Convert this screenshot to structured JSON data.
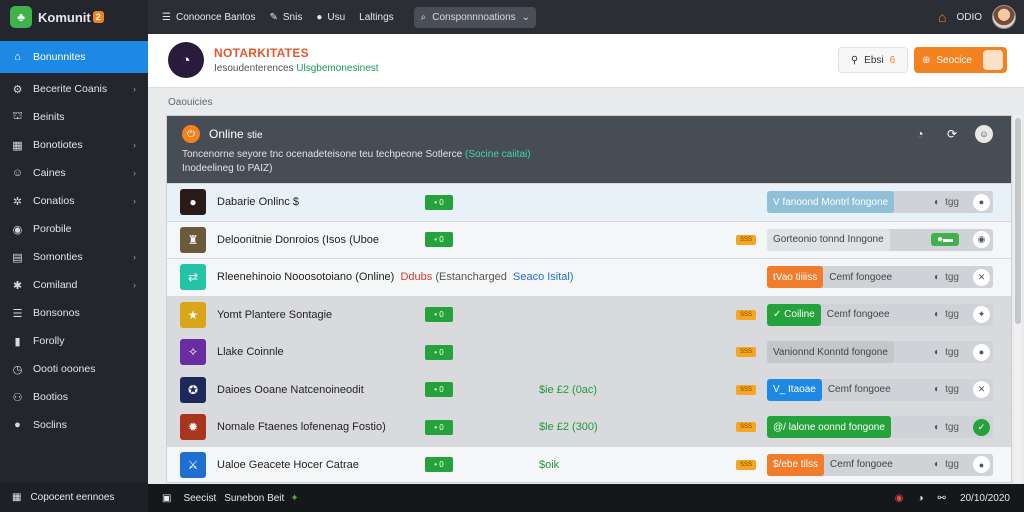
{
  "app": {
    "brand": "Komunit",
    "brand_badge": "2"
  },
  "sidebar": {
    "items": [
      {
        "label": "Bonunnites",
        "icon": "home-icon",
        "glyph": "⌂",
        "chevron": false,
        "active": true
      },
      {
        "label": "Becerite Coanis",
        "icon": "gear-icon",
        "glyph": "⚙",
        "chevron": true
      },
      {
        "label": "Beinits",
        "icon": "bank-icon",
        "glyph": "⛫",
        "chevron": false
      },
      {
        "label": "Bonotiotes",
        "icon": "grid-icon",
        "glyph": "▦",
        "chevron": true
      },
      {
        "label": "Caines",
        "icon": "user-icon",
        "glyph": "☺",
        "chevron": true
      },
      {
        "label": "Conatios",
        "icon": "settings-icon",
        "glyph": "✲",
        "chevron": true
      },
      {
        "label": "Porobile",
        "icon": "globe-icon",
        "glyph": "◉",
        "chevron": false
      },
      {
        "label": "Somonties",
        "icon": "layers-icon",
        "glyph": "▤",
        "chevron": true
      },
      {
        "label": "Comiland",
        "icon": "cog-icon",
        "glyph": "✱",
        "chevron": true
      },
      {
        "label": "Bonsonos",
        "icon": "list-icon",
        "glyph": "☰",
        "chevron": false
      },
      {
        "label": "Forolly",
        "icon": "book-icon",
        "glyph": "▮",
        "chevron": false
      },
      {
        "label": "Oooti ooones",
        "icon": "clock-icon",
        "glyph": "◷",
        "chevron": false
      },
      {
        "label": "Bootios",
        "icon": "users-icon",
        "glyph": "⚇",
        "chevron": false
      },
      {
        "label": "Soclins",
        "icon": "circle-icon",
        "glyph": "●",
        "chevron": false
      }
    ],
    "footer": "Copocent eennoes"
  },
  "topbar": {
    "items": [
      {
        "label": "Conoonce Bantos",
        "icon": "menu-icon",
        "glyph": "☰"
      },
      {
        "label": "Snis",
        "icon": "wand-icon",
        "glyph": "✎"
      },
      {
        "label": "Usu",
        "icon": "chat-icon",
        "glyph": "●"
      },
      {
        "label": "Laltings",
        "icon": "",
        "glyph": ""
      }
    ],
    "search_value": "Consponnnoations",
    "user_label": "ODIO"
  },
  "header": {
    "title": "NOTARKITATES",
    "subtitle_plain": "Iesoudenterences",
    "subtitle_green": "Ulsgbemonesinest",
    "ghost_button": "Ebsi",
    "ghost_badge": "6",
    "primary_button": "Seocice"
  },
  "breadcrumb": "Oaouicies",
  "panel": {
    "title": "Online",
    "title_suffix": "stie",
    "desc_line1": "Toncenorne seyore tnc ocenadeteisone teu techpeone Sotlerce",
    "desc_highlight": "(Socine caiitai)",
    "desc_line2": "Inodeelineg to PAIZ)"
  },
  "rows": [
    {
      "name": "Dabarie Onlinc $",
      "badge": "• 0",
      "price": "",
      "tag": "",
      "pill_seg": "V fanoond Montrl fongone",
      "pill_color": "#8fc0d8",
      "pill_rest": "",
      "meta_icon": "◐",
      "meta_text": "tgg",
      "end_glyph": "●",
      "shade": "blue",
      "icon_bg": "#2b1a1a",
      "icon_glyph": "●"
    },
    {
      "name": "Deloonitnie Donroios (Isos (Uboe",
      "badge": "• 0",
      "price": "",
      "tag": "SSS",
      "pill_seg": "Gorteonio tonnd Inngone",
      "pill_color": "#e0e2e5",
      "pill_seg_text": "#444",
      "pill_rest": "",
      "meta_icon": "▬",
      "meta_text": "",
      "end_glyph": "◉",
      "shade": "light",
      "icon_bg": "#6a5a3a",
      "icon_glyph": "♜",
      "green_chip": true
    },
    {
      "name": "Rleenehinoio Nooosotoiano (Online)",
      "name_red": "Ddubs",
      "name_muted": "(Estancharged",
      "name_blue": "Seaco Isital)",
      "badge": "",
      "price": "",
      "tag": "",
      "pill_seg": "tVao tiiiiss",
      "pill_color": "#f07c2c",
      "pill_rest": "Cemf fongoee",
      "meta_icon": "◐",
      "meta_text": "tgg",
      "end_glyph": "✕",
      "shade": "light",
      "icon_bg": "#22c3a6",
      "icon_glyph": "⇄"
    },
    {
      "name": "Yomt Plantere Sontagie",
      "badge": "• 0",
      "price": "",
      "tag": "SSS",
      "pill_seg": "✓ Coiline",
      "pill_color": "#24a33a",
      "pill_rest": "Cemf fongoee",
      "meta_icon": "◐",
      "meta_text": "tgg",
      "end_glyph": "✦",
      "shade": "shade",
      "icon_bg": "#d9a51b",
      "icon_glyph": "★"
    },
    {
      "name": "Llake Coinnle",
      "badge": "• 0",
      "price": "",
      "tag": "SSS",
      "pill_seg": "Vanionnd Konntd fongone",
      "pill_color": "#c3c6ca",
      "pill_seg_text": "#444",
      "pill_rest": "",
      "meta_icon": "◐",
      "meta_text": "tgg",
      "end_glyph": "●",
      "shade": "shade",
      "icon_bg": "#6a2ca0",
      "icon_glyph": "✧"
    },
    {
      "name": "Daioes Ooane Natcenoineodit",
      "badge": "• 0",
      "price": "$ie £2 (0ac)",
      "tag": "SSS",
      "pill_seg": "V_ Itaoae",
      "pill_color": "#1e88e5",
      "pill_rest": "Cemf fongoee",
      "meta_icon": "◐",
      "meta_text": "tgg",
      "end_glyph": "✕",
      "shade": "shade",
      "icon_bg": "#1b2a5a",
      "icon_glyph": "✪"
    },
    {
      "name": "Nomale Ftaenes lofenenag Fostio)",
      "badge": "• 0",
      "price": "$le £2 (300)",
      "tag": "SSS",
      "pill_seg": "@/ lalone oonnd fongone",
      "pill_color": "#24a33a",
      "pill_rest": "",
      "meta_icon": "◐",
      "meta_text": "tgg",
      "end_glyph": "✓",
      "shade": "shade",
      "icon_bg": "#a8361e",
      "icon_glyph": "✹",
      "end_green": true
    },
    {
      "name": "Ualoe Geacete Hocer Catrae",
      "badge": "• 0",
      "price": "$oik",
      "tag": "SSS",
      "pill_seg": "$/ebe tilss",
      "pill_color": "#f07c2c",
      "pill_rest": "Cemf fongoee",
      "meta_icon": "◐",
      "meta_text": "tgg",
      "end_glyph": "●",
      "shade": "light",
      "icon_bg": "#1f6fd1",
      "icon_glyph": "⚔"
    }
  ],
  "bottombar": {
    "left_label": "Seecist",
    "left_label2": "Sunebon Beit",
    "clock": "20/10/2020"
  }
}
